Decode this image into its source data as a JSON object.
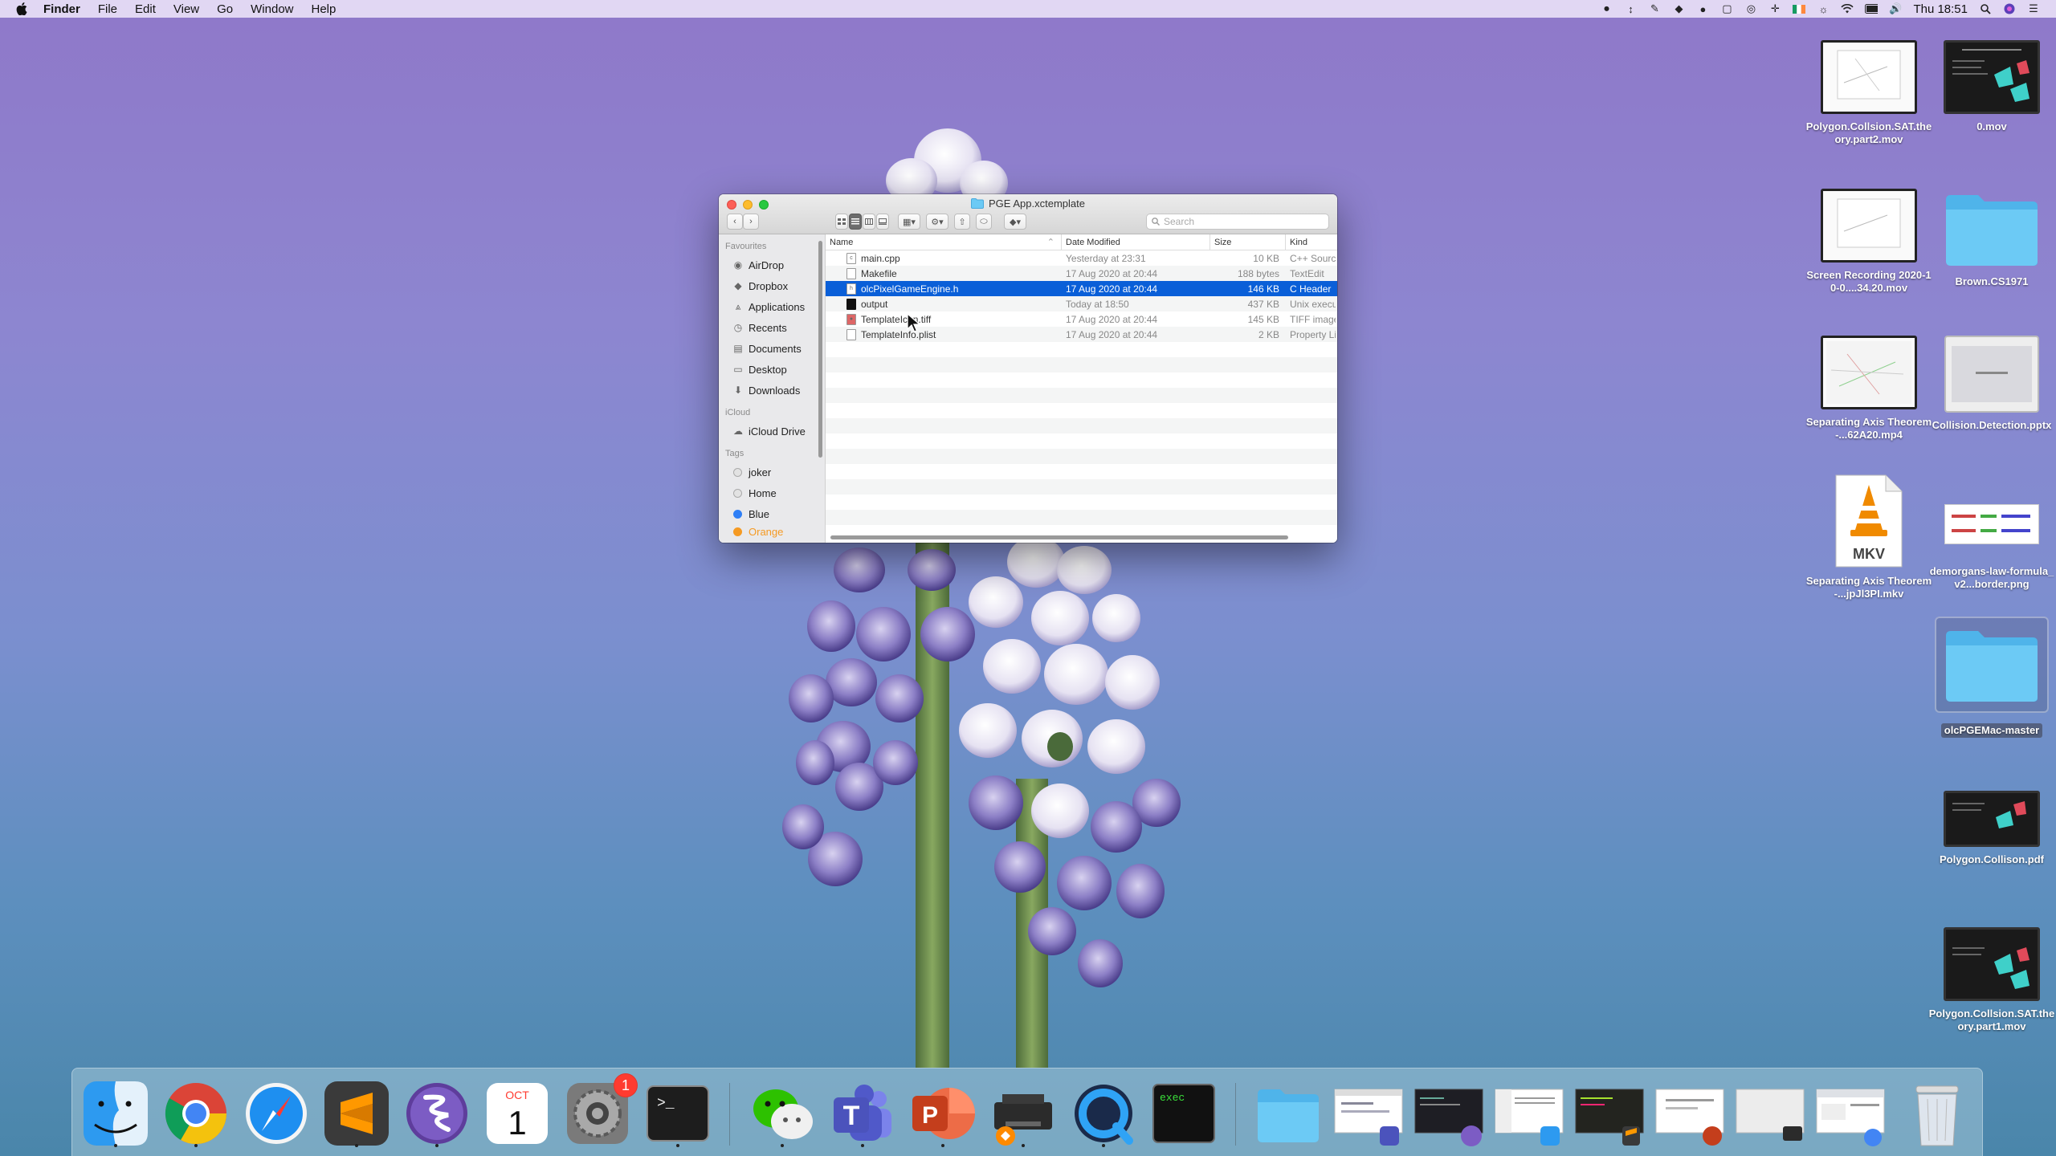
{
  "menubar": {
    "app_name": "Finder",
    "menus": [
      "File",
      "Edit",
      "View",
      "Go",
      "Window",
      "Help"
    ],
    "clock": "Thu 18:51"
  },
  "finder": {
    "title": "PGE App.xctemplate",
    "search_placeholder": "Search",
    "sidebar": {
      "favourites_heading": "Favourites",
      "favourites": [
        {
          "label": "AirDrop",
          "icon": "airdrop-icon"
        },
        {
          "label": "Dropbox",
          "icon": "dropbox-icon"
        },
        {
          "label": "Applications",
          "icon": "applications-icon"
        },
        {
          "label": "Recents",
          "icon": "recents-icon"
        },
        {
          "label": "Documents",
          "icon": "documents-icon"
        },
        {
          "label": "Desktop",
          "icon": "desktop-icon"
        },
        {
          "label": "Downloads",
          "icon": "downloads-icon"
        }
      ],
      "icloud_heading": "iCloud",
      "icloud": [
        {
          "label": "iCloud Drive",
          "icon": "cloud-icon"
        }
      ],
      "tags_heading": "Tags",
      "tags": [
        {
          "label": "joker",
          "color": "#d0d0d0"
        },
        {
          "label": "Home",
          "color": "#d0d0d0"
        },
        {
          "label": "Blue",
          "color": "#2f7ff6"
        },
        {
          "label": "Orange",
          "color": "#f59a23"
        }
      ]
    },
    "columns": {
      "name": "Name",
      "date": "Date Modified",
      "size": "Size",
      "kind": "Kind"
    },
    "files": [
      {
        "name": "main.cpp",
        "date": "Yesterday at 23:31",
        "size": "10 KB",
        "kind": "C++ Source"
      },
      {
        "name": "Makefile",
        "date": "17 Aug 2020 at 20:44",
        "size": "188 bytes",
        "kind": "TextEdit"
      },
      {
        "name": "olcPixelGameEngine.h",
        "date": "17 Aug 2020 at 20:44",
        "size": "146 KB",
        "kind": "C Header"
      },
      {
        "name": "output",
        "date": "Today at 18:50",
        "size": "437 KB",
        "kind": "Unix executable"
      },
      {
        "name": "TemplateIcon.tiff",
        "date": "17 Aug 2020 at 20:44",
        "size": "145 KB",
        "kind": "TIFF image"
      },
      {
        "name": "TemplateInfo.plist",
        "date": "17 Aug 2020 at 20:44",
        "size": "2 KB",
        "kind": "Property List"
      }
    ],
    "selected_index": 2
  },
  "desktop_icons": [
    {
      "label": "Polygon.Collsion.SAT.theory.part2.mov"
    },
    {
      "label": "0.mov"
    },
    {
      "label": "Screen Recording 2020-10-0....34.20.mov"
    },
    {
      "label": "Brown.CS1971"
    },
    {
      "label": "Separating Axis Theorem -...62A20.mp4"
    },
    {
      "label": "Collision.Detection.pptx"
    },
    {
      "label": "Separating Axis Theorem -...jpJl3PI.mkv",
      "badge": "MKV"
    },
    {
      "label": "demorgans-law-formula_v2...border.png"
    },
    {
      "label": "olcPGEMac-master"
    },
    {
      "label": "Polygon.Collison.pdf"
    },
    {
      "label": "Polygon.Collsion.SAT.theory.part1.mov"
    }
  ],
  "dock": {
    "apps": [
      {
        "name": "finder-icon"
      },
      {
        "name": "chrome-icon"
      },
      {
        "name": "safari-icon"
      },
      {
        "name": "sublime-text-icon"
      },
      {
        "name": "emacs-icon"
      },
      {
        "name": "calendar-icon",
        "month": "OCT",
        "day": "1"
      },
      {
        "name": "system-preferences-icon",
        "badge": "1"
      },
      {
        "name": "terminal-icon",
        "prompt": ">_"
      },
      {
        "name": "wechat-icon"
      },
      {
        "name": "teams-icon"
      },
      {
        "name": "powerpoint-icon"
      },
      {
        "name": "printer-icon"
      },
      {
        "name": "quicktime-icon"
      },
      {
        "name": "exec-icon",
        "label": "exec"
      }
    ],
    "accent_colors": {
      "selection": "#0a5fd8",
      "folder": "#5ec2f3"
    }
  }
}
